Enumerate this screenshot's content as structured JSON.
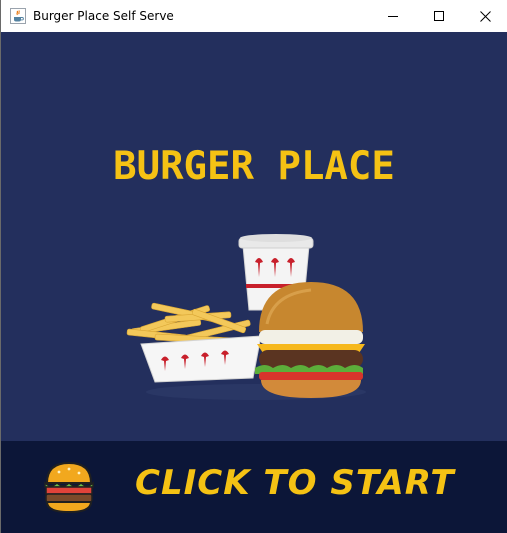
{
  "window": {
    "title": "Burger Place Self Serve",
    "icon": "java-cup-icon",
    "controls": [
      "minimize-icon",
      "maximize-icon",
      "close-icon"
    ]
  },
  "main": {
    "heading": "BURGER PLACE",
    "hero_image": "burger-combo-meal-image",
    "background_color": "#232f5d",
    "accent_color": "#f5c214"
  },
  "start_bar": {
    "label": "CLICK TO START",
    "icon": "burger-icon",
    "background_color": "#0c1638"
  }
}
